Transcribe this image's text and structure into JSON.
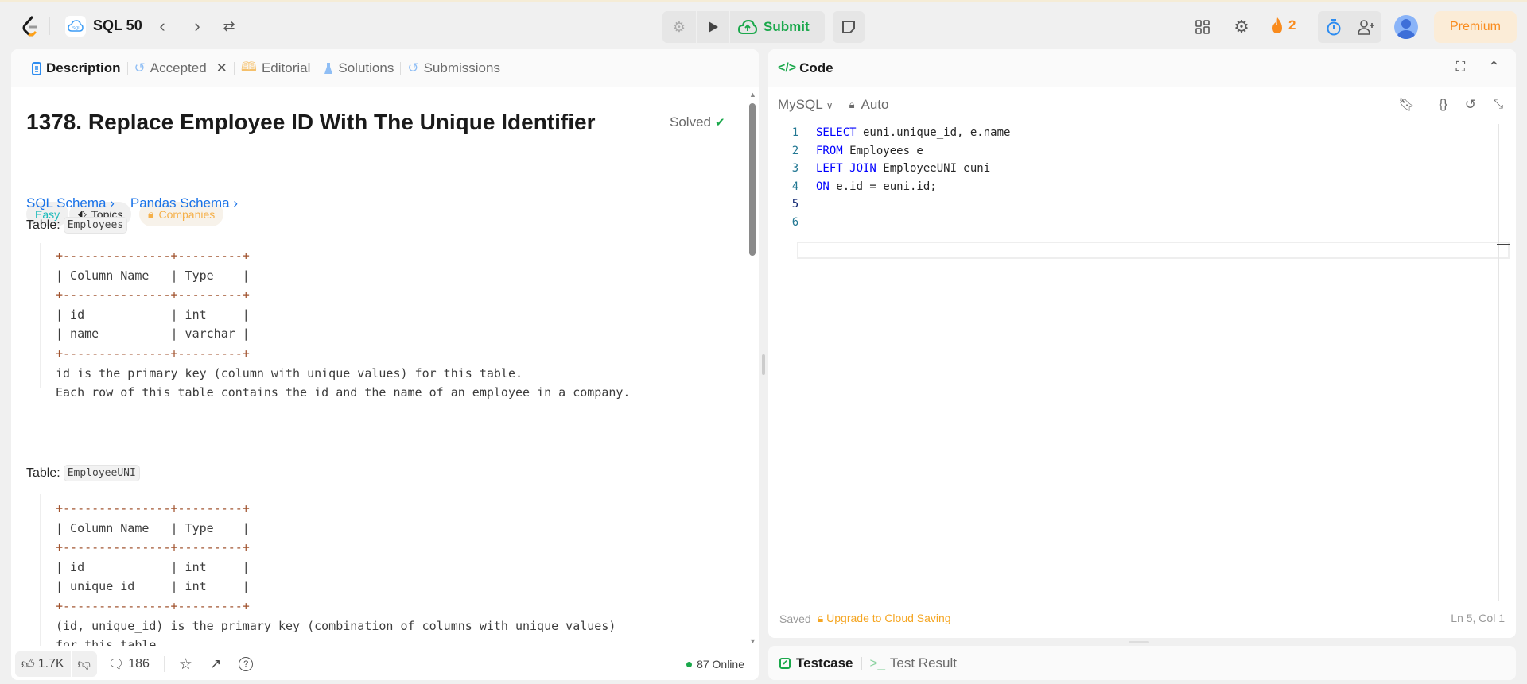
{
  "topbar": {
    "study_plan": "SQL 50",
    "submit_label": "Submit",
    "streak_count": "2",
    "premium_label": "Premium"
  },
  "left_tabs": [
    {
      "label": "Description"
    },
    {
      "label": "Accepted"
    },
    {
      "label": "Editorial"
    },
    {
      "label": "Solutions"
    },
    {
      "label": "Submissions"
    }
  ],
  "problem": {
    "title": "1378. Replace Employee ID With The Unique Identifier",
    "status": "Solved",
    "difficulty": "Easy",
    "topics_label": "Topics",
    "companies_label": "Companies",
    "sql_schema_link": "SQL Schema",
    "pandas_schema_link": "Pandas Schema",
    "table_prefix": "Table:",
    "tables": [
      {
        "name": "Employees",
        "ascii": "+---------------+---------+\n| Column Name   | Type    |\n+---------------+---------+\n| id            | int     |\n| name          | varchar |\n+---------------+---------+\nid is the primary key (column with unique values) for this table.\nEach row of this table contains the id and the name of an employee in a company."
      },
      {
        "name": "EmployeeUNI",
        "ascii": "+---------------+---------+\n| Column Name   | Type    |\n+---------------+---------+\n| id            | int     |\n| unique_id     | int     |\n+---------------+---------+\n(id, unique_id) is the primary key (combination of columns with unique values)\nfor this table."
      }
    ]
  },
  "footer_left": {
    "likes": "1.7K",
    "comments": "186",
    "online": "87 Online"
  },
  "code_panel": {
    "title": "Code",
    "language": "MySQL",
    "mode": "Auto",
    "lines": [
      {
        "num": "1",
        "kw": "SELECT",
        "rest": " euni.unique_id, e.name"
      },
      {
        "num": "2",
        "kw": "FROM",
        "rest": " Employees e"
      },
      {
        "num": "3",
        "kw": "LEFT JOIN",
        "rest": " EmployeeUNI euni"
      },
      {
        "num": "4",
        "kw": "ON",
        "rest": " e.id = euni.id;"
      },
      {
        "num": "5",
        "kw": "",
        "rest": ""
      },
      {
        "num": "6",
        "kw": "",
        "rest": ""
      }
    ],
    "saved": "Saved",
    "upgrade": "Upgrade to Cloud Saving",
    "cursor_pos": "Ln 5, Col 1"
  },
  "bottom_tabs": {
    "testcase": "Testcase",
    "test_result": "Test Result"
  }
}
